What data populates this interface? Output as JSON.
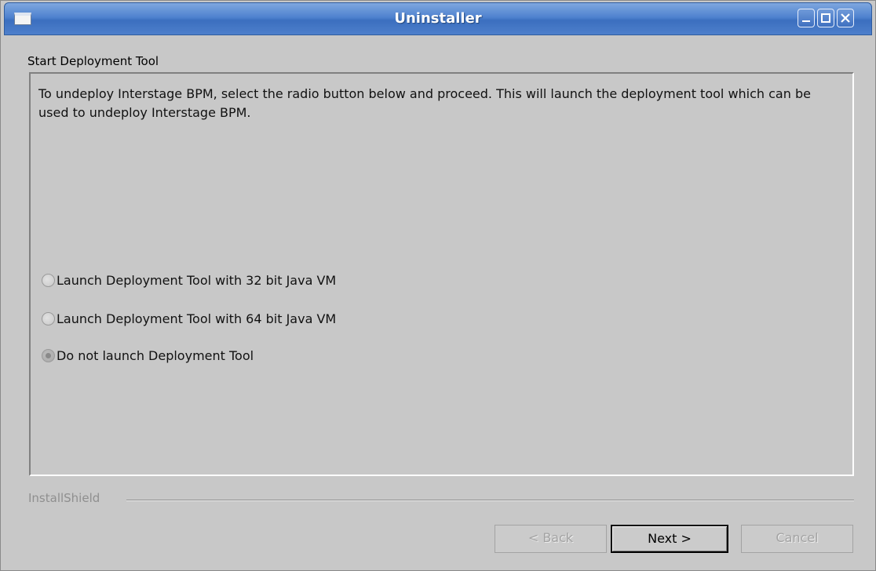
{
  "window": {
    "title": "Uninstaller",
    "controls": {
      "minimize": "minimize-icon",
      "maximize": "maximize-icon",
      "close": "close-icon"
    }
  },
  "main": {
    "section_title": "Start Deployment Tool",
    "description": "To undeploy Interstage BPM, select the radio button below and proceed. This will launch the deployment tool which can be used to undeploy Interstage BPM.",
    "options": [
      {
        "label": "Launch Deployment Tool with 32 bit Java VM",
        "selected": false
      },
      {
        "label": "Launch Deployment Tool with 64 bit Java VM",
        "selected": false
      },
      {
        "label": "Do not launch Deployment Tool",
        "selected": true
      }
    ]
  },
  "footer": {
    "brand": "InstallShield",
    "buttons": {
      "back": "< Back",
      "next": "Next >",
      "cancel": "Cancel"
    }
  },
  "colors": {
    "titlebar": "#3b6fbf",
    "window_bg": "#c8c8c8",
    "disabled_text": "#a3a3a3"
  }
}
